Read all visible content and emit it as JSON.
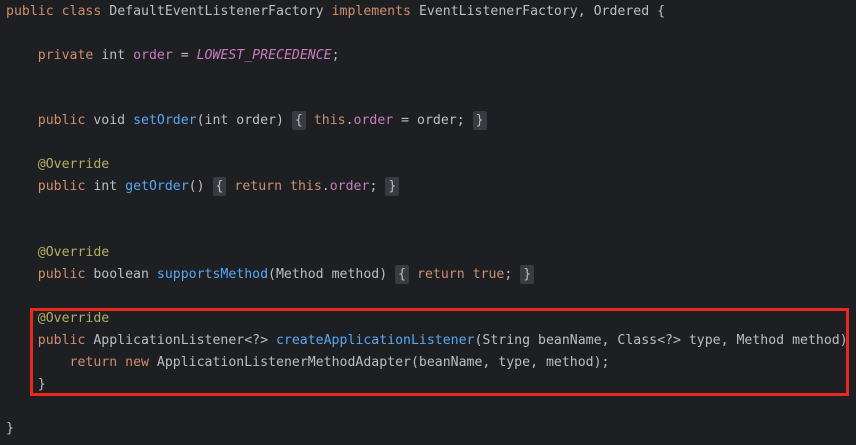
{
  "code": {
    "class_decl": {
      "kw_public": "public",
      "kw_class": "class",
      "name": "DefaultEventListenerFactory",
      "kw_implements": "implements",
      "interfaces": "EventListenerFactory, Ordered {"
    },
    "field_order": {
      "kw_private": "private",
      "type": "int",
      "name": "order",
      "eq": " = ",
      "value": "LOWEST_PRECEDENCE",
      "semi": ";"
    },
    "set_order": {
      "kw_public": "public",
      "kw_void": "void",
      "name": "setOrder",
      "params": "(int order)",
      "open": "{",
      "kw_this": "this",
      "dot": ".",
      "field": "order",
      "rest": " = order;",
      "close": "}"
    },
    "get_order": {
      "annotation": "@Override",
      "kw_public": "public",
      "type": "int",
      "name": "getOrder",
      "params": "()",
      "open": "{",
      "kw_return": "return",
      "kw_this": "this",
      "dot": ".",
      "field": "order",
      "semi": ";",
      "close": "}"
    },
    "supports_method": {
      "annotation": "@Override",
      "kw_public": "public",
      "type": "boolean",
      "name": "supportsMethod",
      "params": "(Method method)",
      "open": "{",
      "kw_return": "return",
      "value": "true",
      "semi": ";",
      "close": "}"
    },
    "create_listener": {
      "annotation": "@Override",
      "kw_public": "public",
      "return_type": "ApplicationListener<?>",
      "name": "createApplicationListener",
      "params": "(String beanName, Class<?> type, Method method) {",
      "kw_return": "return",
      "kw_new": "new",
      "body_rest": "ApplicationListenerMethodAdapter(beanName, type, method);",
      "close": "}"
    },
    "class_close": "}"
  },
  "colors": {
    "background": "#1e1f22",
    "keyword": "#cf8e6d",
    "method": "#56a8f5",
    "field": "#c77dbb",
    "annotation": "#b3ae60",
    "highlight_border": "#e8291c"
  }
}
